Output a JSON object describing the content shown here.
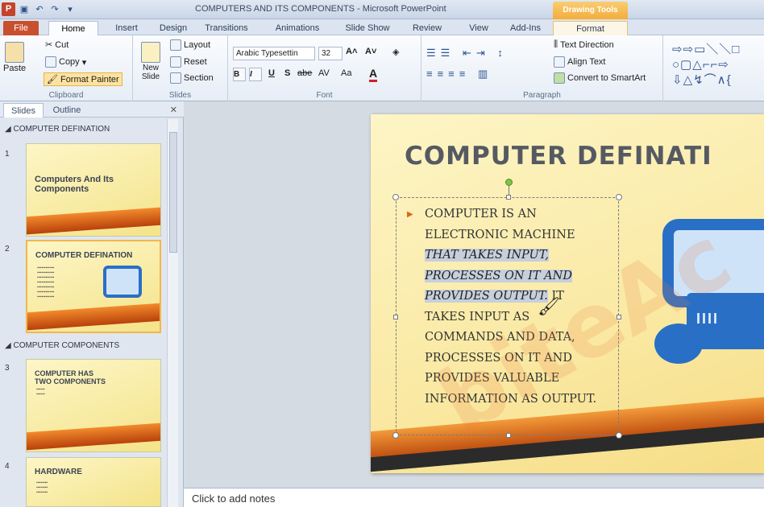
{
  "window": {
    "title": "COMPUTERS AND ITS COMPONENTS - Microsoft PowerPoint",
    "context_tab_group": "Drawing Tools"
  },
  "qat": {
    "app_icon": "P",
    "save_icon": "save-icon",
    "undo": "↶",
    "redo": "↷",
    "more": "▾"
  },
  "tabs": [
    "File",
    "Home",
    "Insert",
    "Design",
    "Transitions",
    "Animations",
    "Slide Show",
    "Review",
    "View",
    "Add-Ins",
    "Format"
  ],
  "ribbon": {
    "clipboard": {
      "label": "Clipboard",
      "paste": "Paste",
      "cut": "Cut",
      "copy": "Copy",
      "format_painter": "Format Painter"
    },
    "slides": {
      "label": "Slides",
      "new_slide": "New Slide",
      "layout": "Layout",
      "reset": "Reset",
      "section": "Section"
    },
    "font": {
      "label": "Font",
      "font_name": "Arabic Typesettin",
      "font_size": "32",
      "bold": "B",
      "italic": "I",
      "underline": "U",
      "shadow": "S",
      "strike": "abe",
      "spacing": "AV",
      "case": "Aa",
      "color": "A"
    },
    "paragraph": {
      "label": "Paragraph",
      "text_direction": "Text Direction",
      "align_text": "Align Text",
      "smartart": "Convert to SmartArt"
    },
    "shapes_glyphs": "⇨⇨▭＼＼□\n○▢△⌐⌐⇨\n⇩△↯⌒∧{"
  },
  "panel": {
    "tab_slides": "Slides",
    "tab_outline": "Outline",
    "close": "✕",
    "sections": [
      "COMPUTER DEFINATION",
      "COMPUTER COMPONENTS"
    ],
    "slides": [
      {
        "num": "1",
        "title": "Computers And Its Components"
      },
      {
        "num": "2",
        "title": "COMPUTER DEFINATION"
      },
      {
        "num": "3",
        "title": "COMPUTER HAS TWO COMPONENTS"
      },
      {
        "num": "4",
        "title": "HARDWARE"
      }
    ]
  },
  "slide": {
    "title": "COMPUTER DEFINATI",
    "lines": [
      "COMPUTER IS AN",
      "ELECTRONIC MACHINE",
      "THAT TAKES INPUT,",
      "PROCESSES ON IT AND",
      "PROVIDES OUTPUT.",
      "IT",
      "TAKES INPUT AS",
      "COMMANDS AND DATA,",
      "PROCESSES ON IT AND",
      "PROVIDES VALUABLE",
      "INFORMATION AS OUTPUT."
    ],
    "monitor_text": "IIII",
    "watermark": "biteAc"
  },
  "notes": {
    "placeholder": "Click to add notes"
  }
}
